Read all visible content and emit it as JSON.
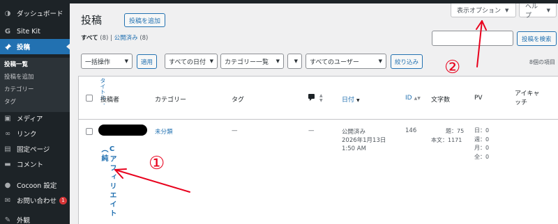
{
  "sidebar": {
    "items": [
      {
        "label": "ダッシュボード",
        "icon": "dashboard-icon",
        "glyph": "◑"
      },
      {
        "label": "Site Kit",
        "icon": "google-g-icon",
        "glyph": "G"
      },
      {
        "label": "投稿",
        "icon": "pin-icon",
        "glyph": "✎"
      },
      {
        "label": "メディア",
        "icon": "media-icon",
        "glyph": "▣"
      },
      {
        "label": "リンク",
        "icon": "link-icon",
        "glyph": "∞"
      },
      {
        "label": "固定ページ",
        "icon": "page-icon",
        "glyph": "▤"
      },
      {
        "label": "コメント",
        "icon": "comment-icon",
        "glyph": "▬"
      },
      {
        "label": "Cocoon 設定",
        "icon": "cocoon-icon",
        "glyph": "●"
      },
      {
        "label": "お問い合わせ",
        "icon": "mail-icon",
        "glyph": "✉",
        "badge": "1"
      },
      {
        "label": "外観",
        "icon": "appearance-icon",
        "glyph": "✎"
      }
    ],
    "submenu": [
      "投稿一覧",
      "投稿を追加",
      "カテゴリー",
      "タグ"
    ]
  },
  "header": {
    "title": "投稿",
    "add_new": "投稿を追加",
    "screen_options": "表示オプション",
    "help": "ヘルプ"
  },
  "views": {
    "all_label": "すべて",
    "all_count": "(8)",
    "separator": "|",
    "published_label": "公開済み",
    "published_count": "(8)"
  },
  "search": {
    "value": "",
    "button": "投稿を検索"
  },
  "filters": {
    "bulk_action": "一括操作",
    "apply": "適用",
    "dates": "すべての日付",
    "categories": "カテゴリー一覧",
    "extra": "",
    "users": "すべてのユーザー",
    "filter_button": "絞り込み",
    "item_count": "8個の項目"
  },
  "table": {
    "title_header_vertical": "タイトル：",
    "columns": {
      "author": "投稿者",
      "categories": "カテゴリー",
      "tags": "タグ",
      "date": "日付",
      "id": "ID",
      "word_count": "文字数",
      "pv": "PV",
      "eyecatch": "アイキャッチ"
    },
    "row": {
      "title_vertical": "Cアフィリエイト（純",
      "category": "未分類",
      "tags": "—",
      "comments": "—",
      "status": "公開済み",
      "date": "2026年1月13日 1:50 AM",
      "id": "146",
      "wc_title": "題：75",
      "wc_body": "本文：1171",
      "pv_day": "日：0",
      "pv_week": "週：0",
      "pv_month": "月：0",
      "pv_total": "全：0"
    }
  },
  "annotations": {
    "label_1": "①",
    "label_2": "②",
    "color": "#e8001c"
  },
  "colors": {
    "sidebar_bg": "#1d2327",
    "accent": "#2271b1",
    "badge": "#d63638"
  }
}
